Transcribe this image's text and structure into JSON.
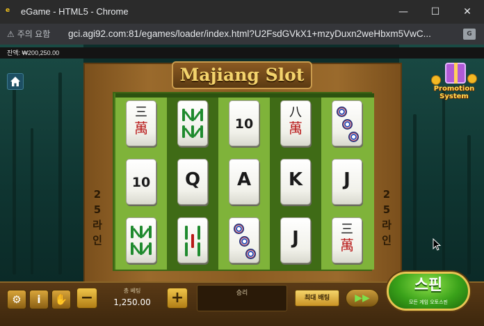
{
  "browser": {
    "window_title": "eGame - HTML5 - Chrome",
    "security_label": "주의 요함",
    "url": "gci.agi92.com:81/egames/loader/index.html?U2FsdGVkX1+mzyDuxn2weHbxm5VwC...",
    "controls": {
      "minimize": "—",
      "maximize": "☐",
      "close": "✕"
    }
  },
  "game": {
    "balance": "잔액: ₩200,250.00",
    "title": "Majiang Slot",
    "promotion": "Promotion System",
    "lines_left": [
      "2",
      "5",
      "라",
      "인"
    ],
    "lines_right": [
      "2",
      "5",
      "라",
      "인"
    ],
    "reels": [
      [
        {
          "kind": "char",
          "top": "三",
          "bot": "萬"
        },
        {
          "kind": "text",
          "label": "10"
        },
        {
          "kind": "bamboo",
          "label": "WM"
        }
      ],
      [
        {
          "kind": "bamboo",
          "label": "WM"
        },
        {
          "kind": "text",
          "label": "Q"
        },
        {
          "kind": "bamboo2",
          "label": "II"
        }
      ],
      [
        {
          "kind": "text",
          "label": "10"
        },
        {
          "kind": "text",
          "label": "A"
        },
        {
          "kind": "dots",
          "label": "3"
        }
      ],
      [
        {
          "kind": "char",
          "top": "八",
          "bot": "萬"
        },
        {
          "kind": "text",
          "label": "K"
        },
        {
          "kind": "text",
          "label": "J"
        }
      ],
      [
        {
          "kind": "dots",
          "label": "3"
        },
        {
          "kind": "text",
          "label": "J"
        },
        {
          "kind": "char",
          "top": "三",
          "bot": "萬"
        }
      ]
    ]
  },
  "controls": {
    "settings_icon": "gear-icon",
    "info_label": "i",
    "paytable_icon": "hand-icon",
    "minus": "−",
    "plus": "+",
    "bet_label": "총 베팅",
    "bet_value": "1,250.00",
    "win_label": "승리",
    "max_bet": "최대 배팅",
    "auto_icon": "fast-forward-icon",
    "spin_label": "스핀",
    "spin_sub": "모든 게임 오토스핀"
  }
}
